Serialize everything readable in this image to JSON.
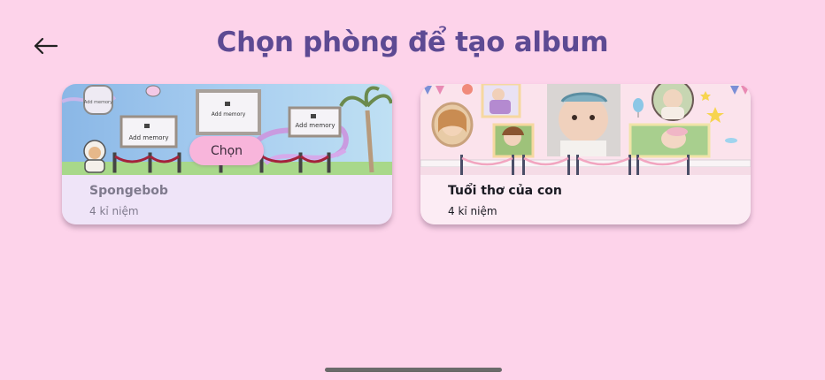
{
  "header": {
    "back_icon": "arrow-left-icon",
    "title": "Chọn phòng để tạo album"
  },
  "rooms": [
    {
      "name": "Spongebob",
      "count": "4 kỉ niệm",
      "choose_label": "Chọn",
      "selected": true,
      "frame_label": "Add memory"
    },
    {
      "name": "Tuổi thơ của con",
      "count": "4 kỉ niệm",
      "selected": false
    }
  ],
  "colors": {
    "background": "#fdd3ea",
    "title": "#5d4a93",
    "button": "#f8b5db"
  }
}
